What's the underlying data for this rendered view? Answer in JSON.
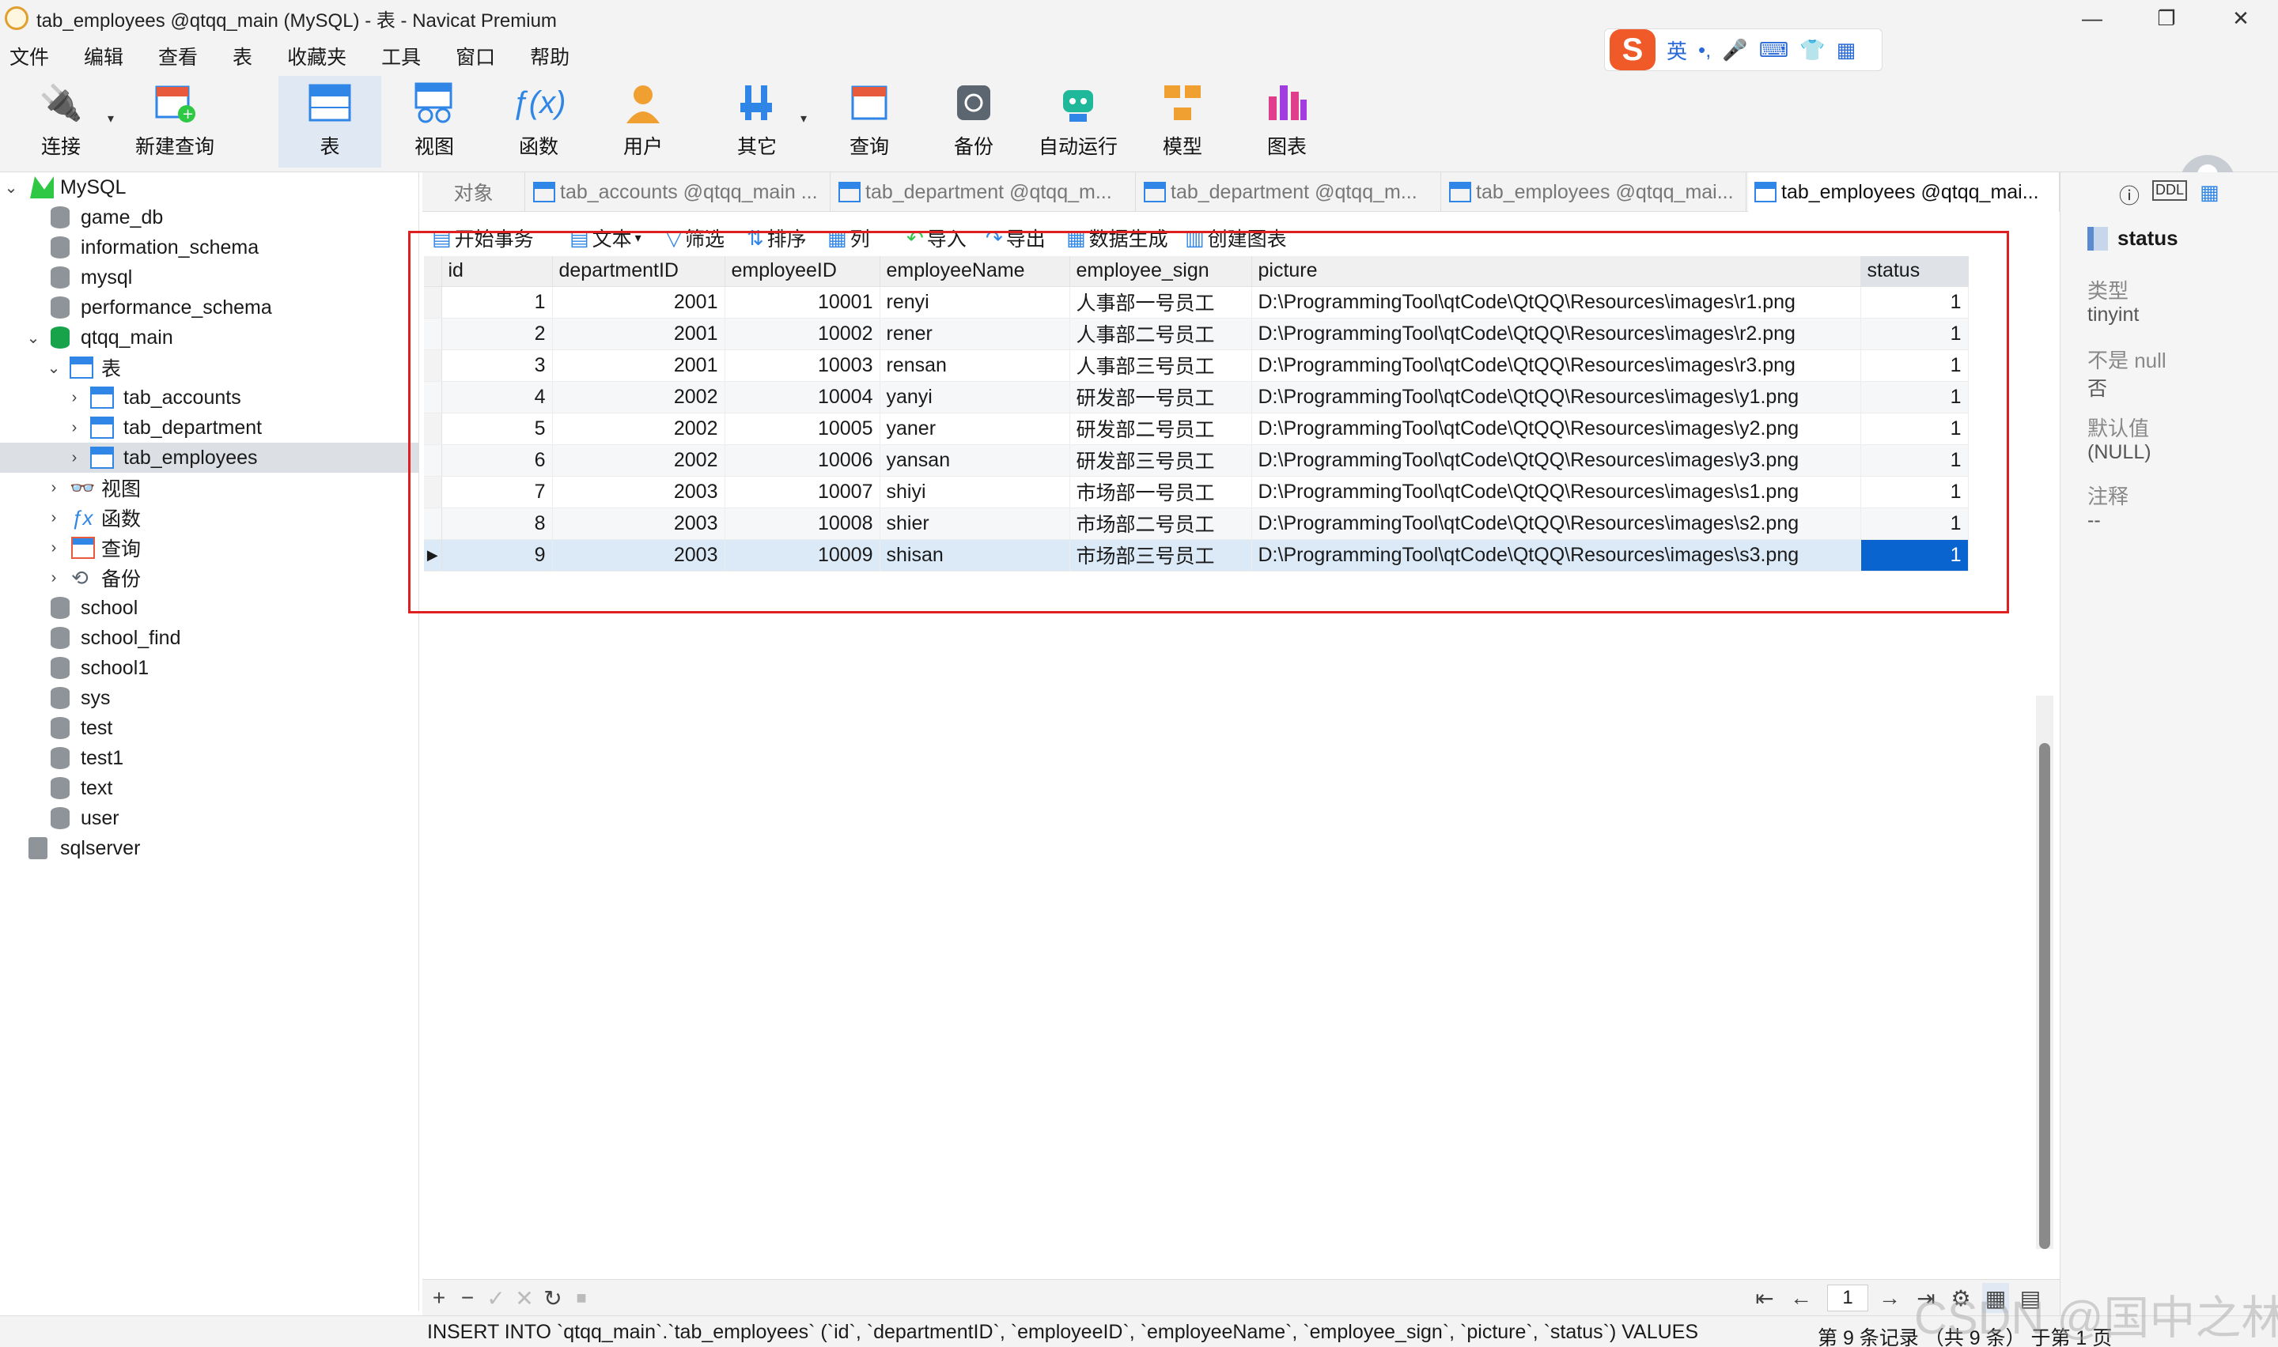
{
  "window": {
    "title": "tab_employees @qtqq_main (MySQL) - 表 - Navicat Premium",
    "minimize": "—",
    "restore": "❐",
    "close": "✕"
  },
  "ime": {
    "logo": "S",
    "mode": "英",
    "punct": "•,",
    "items": [
      "🎤",
      "⌨",
      "👕",
      "▦"
    ]
  },
  "menu": [
    "文件",
    "编辑",
    "查看",
    "表",
    "收藏夹",
    "工具",
    "窗口",
    "帮助"
  ],
  "toolbar": {
    "connect": "连接",
    "new_query": "新建查询",
    "table": "表",
    "view": "视图",
    "function": "函数",
    "user": "用户",
    "other": "其它",
    "query": "查询",
    "backup": "备份",
    "automation": "自动运行",
    "model": "模型",
    "chart": "图表"
  },
  "sidebar": {
    "root": "MySQL",
    "databases": [
      "game_db",
      "information_schema",
      "mysql",
      "performance_schema"
    ],
    "open_db": "qtqq_main",
    "tables_node": "表",
    "tables": [
      "tab_accounts",
      "tab_department",
      "tab_employees"
    ],
    "views_node": "视图",
    "functions_node": "函数",
    "queries_node": "查询",
    "backups_node": "备份",
    "more_dbs": [
      "school",
      "school_find",
      "school1",
      "sys",
      "test",
      "test1",
      "text",
      "user"
    ],
    "server2": "sqlserver"
  },
  "tabs": {
    "objects": "对象",
    "items": [
      "tab_accounts @qtqq_main ...",
      "tab_department @qtqq_m...",
      "tab_department @qtqq_m...",
      "tab_employees @qtqq_mai...",
      "tab_employees @qtqq_mai..."
    ]
  },
  "data_toolbar": {
    "begin_tx": "开始事务",
    "text": "文本",
    "filter": "筛选",
    "sort": "排序",
    "columns": "列",
    "import": "导入",
    "export": "导出",
    "data_gen": "数据生成",
    "create_chart": "创建图表"
  },
  "grid": {
    "columns": [
      "id",
      "departmentID",
      "employeeID",
      "employeeName",
      "employee_sign",
      "picture",
      "status"
    ],
    "rows": [
      [
        "1",
        "2001",
        "10001",
        "renyi",
        "人事部一号员工",
        "D:\\ProgrammingTool\\qtCode\\QtQQ\\Resources\\images\\r1.png",
        "1"
      ],
      [
        "2",
        "2001",
        "10002",
        "rener",
        "人事部二号员工",
        "D:\\ProgrammingTool\\qtCode\\QtQQ\\Resources\\images\\r2.png",
        "1"
      ],
      [
        "3",
        "2001",
        "10003",
        "rensan",
        "人事部三号员工",
        "D:\\ProgrammingTool\\qtCode\\QtQQ\\Resources\\images\\r3.png",
        "1"
      ],
      [
        "4",
        "2002",
        "10004",
        "yanyi",
        "研发部一号员工",
        "D:\\ProgrammingTool\\qtCode\\QtQQ\\Resources\\images\\y1.png",
        "1"
      ],
      [
        "5",
        "2002",
        "10005",
        "yaner",
        "研发部二号员工",
        "D:\\ProgrammingTool\\qtCode\\QtQQ\\Resources\\images\\y2.png",
        "1"
      ],
      [
        "6",
        "2002",
        "10006",
        "yansan",
        "研发部三号员工",
        "D:\\ProgrammingTool\\qtCode\\QtQQ\\Resources\\images\\y3.png",
        "1"
      ],
      [
        "7",
        "2003",
        "10007",
        "shiyi",
        "市场部一号员工",
        "D:\\ProgrammingTool\\qtCode\\QtQQ\\Resources\\images\\s1.png",
        "1"
      ],
      [
        "8",
        "2003",
        "10008",
        "shier",
        "市场部二号员工",
        "D:\\ProgrammingTool\\qtCode\\QtQQ\\Resources\\images\\s2.png",
        "1"
      ],
      [
        "9",
        "2003",
        "10009",
        "shisan",
        "市场部三号员工",
        "D:\\ProgrammingTool\\qtCode\\QtQQ\\Resources\\images\\s3.png",
        "1"
      ]
    ],
    "current_row_marker": "▶"
  },
  "bottom_nav": {
    "add": "+",
    "delete": "−",
    "apply": "✓",
    "cancel": "✕",
    "refresh": "↻",
    "stop": "■",
    "first": "⇤",
    "prev": "←",
    "page": "1",
    "next": "→",
    "last": "⇥",
    "settings": "⚙",
    "grid_view": "▦",
    "form_view": "▤"
  },
  "status": {
    "sql": "INSERT INTO `qtqq_main`.`tab_employees` (`id`, `departmentID`, `employeeID`, `employeeName`, `employee_sign`, `picture`, `status`) VALUES",
    "record": "第 9 条记录 （共 9 条） 于第 1 页"
  },
  "info_panel": {
    "field_name": "status",
    "type_label": "类型",
    "type_value": "tinyint",
    "notnull_label": "不是 null",
    "notnull_value": "否",
    "default_label": "默认值",
    "default_value": "(NULL)",
    "comment_label": "注释",
    "comment_value": "--"
  },
  "watermark": "CSDN @国中之林"
}
